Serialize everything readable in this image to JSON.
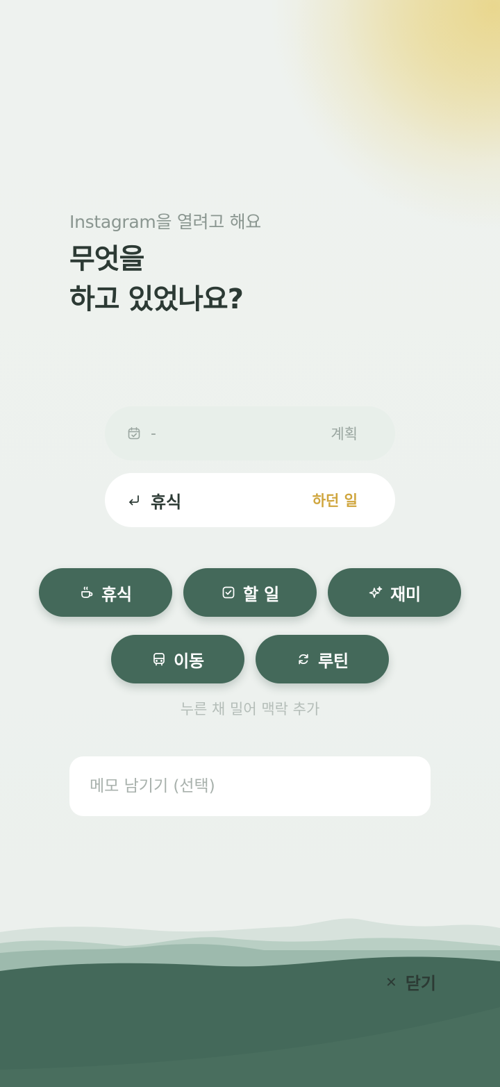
{
  "colors": {
    "background": "#eef2ef",
    "sun": "#e8d487",
    "heading": "#2c3a34",
    "button": "#44695a",
    "accent": "#cfa53d",
    "hill_dark": "#44695a"
  },
  "header": {
    "subtitle": "Instagram을 열려고 해요",
    "title_line1": "무엇을",
    "title_line2": "하고 있었나요?"
  },
  "plan_row": {
    "icon": "calendar-check-icon",
    "value": "-",
    "tag": "계획"
  },
  "doing_row": {
    "icon": "return-arrow-icon",
    "value": "휴식",
    "tag": "하던 일"
  },
  "categories": [
    {
      "label": "휴식",
      "icon": "coffee-cup-icon"
    },
    {
      "label": "할 일",
      "icon": "checkbox-icon"
    },
    {
      "label": "재미",
      "icon": "sparkle-icon"
    },
    {
      "label": "이동",
      "icon": "bus-icon"
    },
    {
      "label": "루틴",
      "icon": "refresh-icon"
    }
  ],
  "hint": "누른 채 밀어 맥락 추가",
  "memo": {
    "placeholder": "메모 남기기 (선택)",
    "value": ""
  },
  "close": {
    "icon": "close-icon",
    "label": "닫기"
  }
}
